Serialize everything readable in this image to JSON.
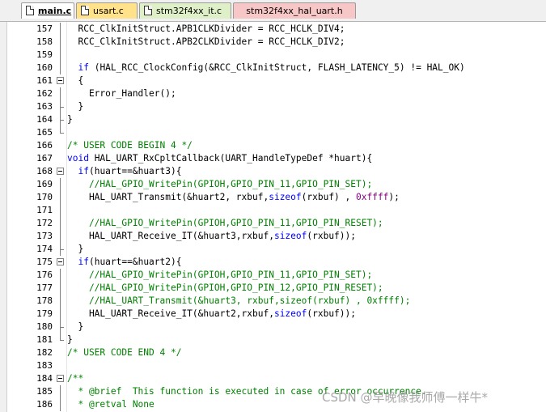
{
  "tabs": [
    {
      "label": "main.c",
      "active": true,
      "color": "#ffffff"
    },
    {
      "label": "usart.c",
      "active": false,
      "color": "#ffe28a"
    },
    {
      "label": "stm32f4xx_it.c",
      "active": false,
      "color": "#dff0c8"
    },
    {
      "label": "stm32f4xx_hal_uart.h",
      "active": false,
      "color": "#f7c6c6"
    }
  ],
  "code": {
    "lines": [
      {
        "num": "157",
        "fold": "line",
        "tokens": [
          {
            "t": "  RCC_ClkInitStruct.APB1CLKDivider = RCC_HCLK_DIV4;",
            "c": ""
          }
        ]
      },
      {
        "num": "158",
        "fold": "line",
        "tokens": [
          {
            "t": "  RCC_ClkInitStruct.APB2CLKDivider = RCC_HCLK_DIV2;",
            "c": ""
          }
        ]
      },
      {
        "num": "159",
        "fold": "line",
        "tokens": []
      },
      {
        "num": "160",
        "fold": "line",
        "tokens": [
          {
            "t": "  ",
            "c": ""
          },
          {
            "t": "if",
            "c": "kw"
          },
          {
            "t": " (HAL_RCC_ClockConfig(&RCC_ClkInitStruct, FLASH_LATENCY_5) != HAL_OK)",
            "c": ""
          }
        ]
      },
      {
        "num": "161",
        "fold": "box",
        "tokens": [
          {
            "t": "  {",
            "c": ""
          }
        ]
      },
      {
        "num": "162",
        "fold": "line",
        "tokens": [
          {
            "t": "    Error_Handler();",
            "c": ""
          }
        ]
      },
      {
        "num": "163",
        "fold": "mid",
        "tokens": [
          {
            "t": "  }",
            "c": ""
          }
        ]
      },
      {
        "num": "164",
        "fold": "mid",
        "tokens": [
          {
            "t": "}",
            "c": ""
          }
        ]
      },
      {
        "num": "165",
        "fold": "end",
        "tokens": []
      },
      {
        "num": "166",
        "fold": "none",
        "tokens": [
          {
            "t": "/* USER CODE BEGIN 4 */",
            "c": "cm"
          }
        ]
      },
      {
        "num": "167",
        "fold": "none",
        "tokens": [
          {
            "t": "void",
            "c": "kw"
          },
          {
            "t": " HAL_UART_RxCpltCallback(UART_HandleTypeDef *huart){",
            "c": ""
          }
        ]
      },
      {
        "num": "168",
        "fold": "box",
        "tokens": [
          {
            "t": "  ",
            "c": ""
          },
          {
            "t": "if",
            "c": "kw"
          },
          {
            "t": "(huart==&huart3){",
            "c": ""
          }
        ]
      },
      {
        "num": "169",
        "fold": "line",
        "tokens": [
          {
            "t": "    //HAL_GPIO_WritePin(GPIOH,GPIO_PIN_11,GPIO_PIN_SET);",
            "c": "cm"
          }
        ]
      },
      {
        "num": "170",
        "fold": "line",
        "tokens": [
          {
            "t": "    HAL_UART_Transmit(&huart2, rxbuf,",
            "c": ""
          },
          {
            "t": "sizeof",
            "c": "kw"
          },
          {
            "t": "(rxbuf) , ",
            "c": ""
          },
          {
            "t": "0xffff",
            "c": "num"
          },
          {
            "t": ");",
            "c": ""
          }
        ]
      },
      {
        "num": "171",
        "fold": "line",
        "tokens": []
      },
      {
        "num": "172",
        "fold": "line",
        "tokens": [
          {
            "t": "    //HAL_GPIO_WritePin(GPIOH,GPIO_PIN_11,GPIO_PIN_RESET);",
            "c": "cm"
          }
        ]
      },
      {
        "num": "173",
        "fold": "line",
        "tokens": [
          {
            "t": "    HAL_UART_Receive_IT(&huart3,rxbuf,",
            "c": ""
          },
          {
            "t": "sizeof",
            "c": "kw"
          },
          {
            "t": "(rxbuf));",
            "c": ""
          }
        ]
      },
      {
        "num": "174",
        "fold": "mid",
        "tokens": [
          {
            "t": "  }",
            "c": ""
          }
        ]
      },
      {
        "num": "175",
        "fold": "box",
        "tokens": [
          {
            "t": "  ",
            "c": ""
          },
          {
            "t": "if",
            "c": "kw"
          },
          {
            "t": "(huart==&huart2){",
            "c": ""
          }
        ]
      },
      {
        "num": "176",
        "fold": "line",
        "tokens": [
          {
            "t": "    //HAL_GPIO_WritePin(GPIOH,GPIO_PIN_11,GPIO_PIN_SET);",
            "c": "cm"
          }
        ]
      },
      {
        "num": "177",
        "fold": "line",
        "tokens": [
          {
            "t": "    //HAL_GPIO_WritePin(GPIOH,GPIO_PIN_12,GPIO_PIN_RESET);",
            "c": "cm"
          }
        ]
      },
      {
        "num": "178",
        "fold": "line",
        "tokens": [
          {
            "t": "    //HAL_UART_Transmit(&huart3, rxbuf,sizeof(rxbuf) , 0xffff);",
            "c": "cm"
          }
        ]
      },
      {
        "num": "179",
        "fold": "line",
        "tokens": [
          {
            "t": "    HAL_UART_Receive_IT(&huart2,rxbuf,",
            "c": ""
          },
          {
            "t": "sizeof",
            "c": "kw"
          },
          {
            "t": "(rxbuf));",
            "c": ""
          }
        ]
      },
      {
        "num": "180",
        "fold": "mid",
        "tokens": [
          {
            "t": "  }",
            "c": ""
          }
        ]
      },
      {
        "num": "181",
        "fold": "end",
        "tokens": [
          {
            "t": "}",
            "c": ""
          }
        ]
      },
      {
        "num": "182",
        "fold": "none",
        "tokens": [
          {
            "t": "/* USER CODE END 4 */",
            "c": "cm"
          }
        ]
      },
      {
        "num": "183",
        "fold": "none",
        "tokens": []
      },
      {
        "num": "184",
        "fold": "box",
        "tokens": [
          {
            "t": "/**",
            "c": "cm"
          }
        ]
      },
      {
        "num": "185",
        "fold": "line",
        "tokens": [
          {
            "t": "  * @brief  This function is executed in case of error occurrence.",
            "c": "cm"
          }
        ]
      },
      {
        "num": "186",
        "fold": "line",
        "tokens": [
          {
            "t": "  * @retval None",
            "c": "cm"
          }
        ]
      }
    ]
  },
  "watermark": "CSDN @早晚像我师傅一样牛*",
  "colors": {
    "keyword": "#0000ff",
    "comment": "#008000",
    "number": "#800080"
  }
}
